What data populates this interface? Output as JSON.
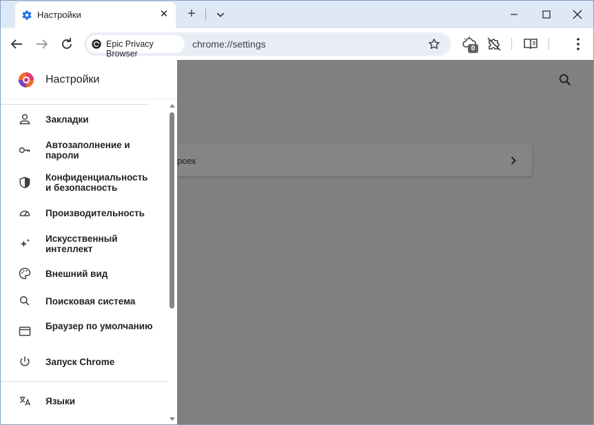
{
  "tab": {
    "title": "Настройки"
  },
  "toolbar": {
    "chip_label": "Epic Privacy Browser",
    "url": "chrome://settings",
    "badge_count": "0"
  },
  "drawer": {
    "title": "Настройки",
    "items": [
      {
        "label": "Закладки",
        "icon": "person-icon"
      },
      {
        "label": "Автозаполнение и пароли",
        "icon": "key-icon"
      },
      {
        "label": "Конфиденциальность и безопасность",
        "icon": "shield-icon"
      },
      {
        "label": "Производительность",
        "icon": "speedometer-icon"
      },
      {
        "label": "Искусственный интеллект",
        "icon": "sparkle-icon"
      },
      {
        "label": "Внешний вид",
        "icon": "palette-icon"
      },
      {
        "label": "Поисковая система",
        "icon": "search-icon"
      },
      {
        "label": "Браузер по умолчанию",
        "icon": "browser-window-icon"
      },
      {
        "label": "Запуск Chrome",
        "icon": "power-icon"
      },
      {
        "label": "Языки",
        "icon": "translate-icon"
      }
    ]
  },
  "main": {
    "card_text": "роек"
  },
  "colors": {
    "accent": "#1a73e8",
    "overlay": "#808080",
    "tab_strip": "#dfe8f6"
  }
}
